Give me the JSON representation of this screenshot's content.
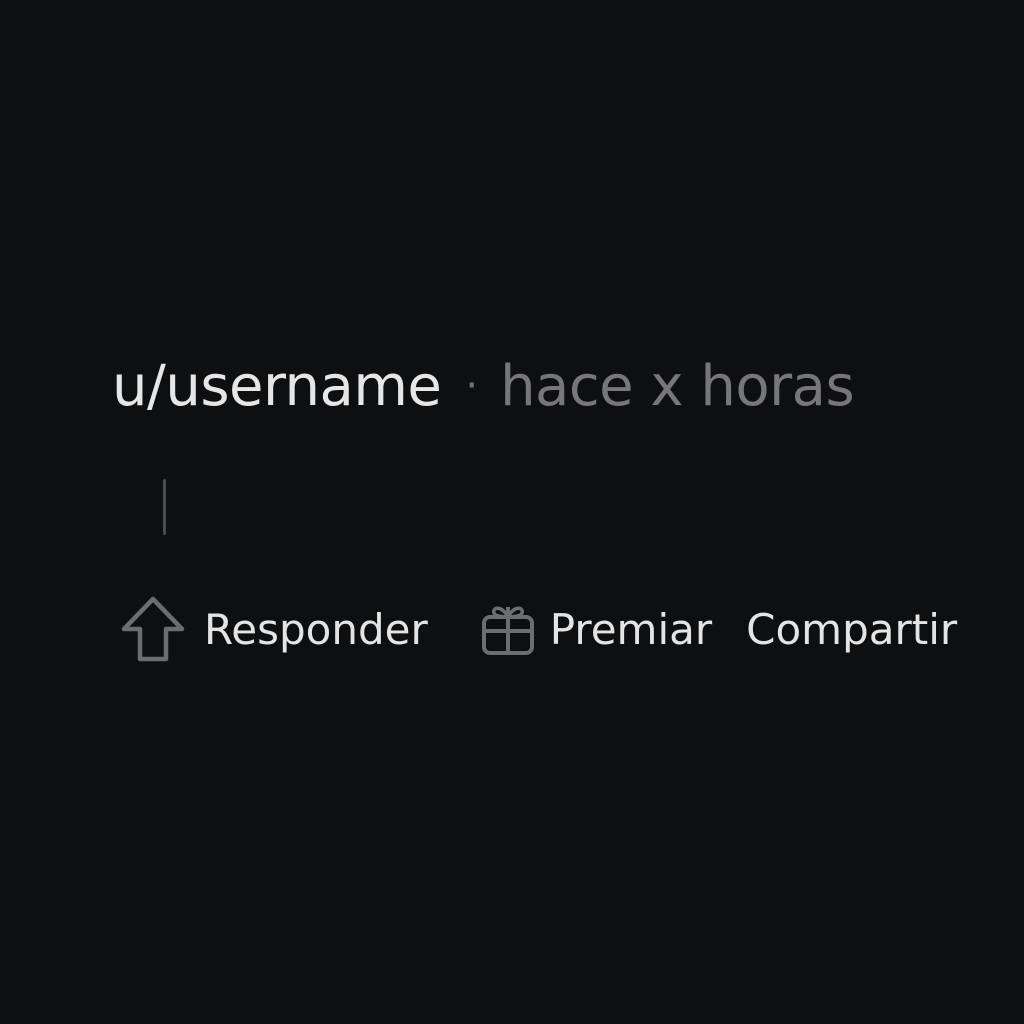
{
  "comment": {
    "username": "u/username",
    "separator": "·",
    "timestamp": "hace x horas"
  },
  "actions": {
    "reply": {
      "label": "Responder",
      "icon": "upvote-arrow-icon"
    },
    "award": {
      "label": "Premiar",
      "icon": "gift-icon"
    },
    "share": {
      "label": "Compartir"
    }
  },
  "colors": {
    "background": "#0e0f11",
    "primary_text": "#e6e6e6",
    "muted_text": "#77777a",
    "icon_stroke": "#6c6d70",
    "thread_line": "#4a4b4e"
  }
}
